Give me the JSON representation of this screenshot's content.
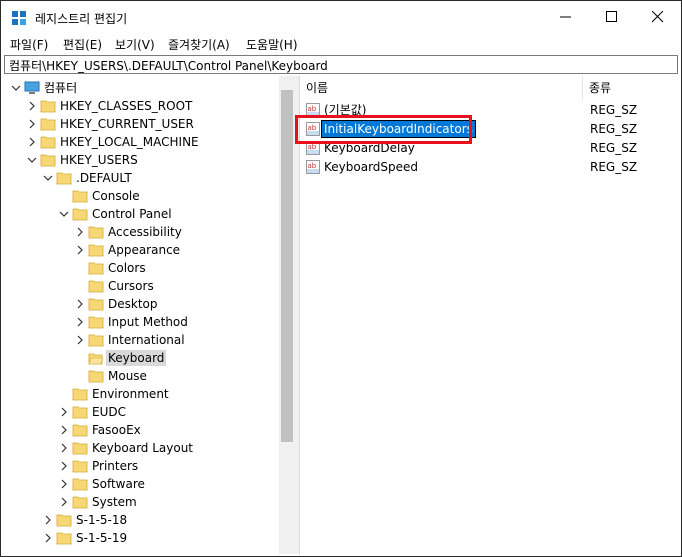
{
  "window": {
    "title": "레지스트리 편집기",
    "app_icon": "registry-editor-icon",
    "controls": {
      "minimize": "minimize-icon",
      "maximize": "maximize-icon",
      "close": "close-icon"
    }
  },
  "menu": [
    "파일(F)",
    "편집(E)",
    "보기(V)",
    "즐겨찾기(A)",
    "도움말(H)"
  ],
  "address": "컴퓨터\\HKEY_USERS\\.DEFAULT\\Control Panel\\Keyboard",
  "tree": [
    {
      "label": "컴퓨터",
      "icon": "computer-icon",
      "depth": 0,
      "expander": "expanded"
    },
    {
      "label": "HKEY_CLASSES_ROOT",
      "icon": "folder-icon",
      "depth": 1,
      "expander": "collapsed"
    },
    {
      "label": "HKEY_CURRENT_USER",
      "icon": "folder-icon",
      "depth": 1,
      "expander": "collapsed"
    },
    {
      "label": "HKEY_LOCAL_MACHINE",
      "icon": "folder-icon",
      "depth": 1,
      "expander": "collapsed"
    },
    {
      "label": "HKEY_USERS",
      "icon": "folder-icon",
      "depth": 1,
      "expander": "expanded"
    },
    {
      "label": ".DEFAULT",
      "icon": "folder-icon",
      "depth": 2,
      "expander": "expanded"
    },
    {
      "label": "Console",
      "icon": "folder-icon",
      "depth": 3,
      "expander": "none"
    },
    {
      "label": "Control Panel",
      "icon": "folder-icon",
      "depth": 3,
      "expander": "expanded"
    },
    {
      "label": "Accessibility",
      "icon": "folder-icon",
      "depth": 4,
      "expander": "collapsed"
    },
    {
      "label": "Appearance",
      "icon": "folder-icon",
      "depth": 4,
      "expander": "collapsed"
    },
    {
      "label": "Colors",
      "icon": "folder-icon",
      "depth": 4,
      "expander": "none"
    },
    {
      "label": "Cursors",
      "icon": "folder-icon",
      "depth": 4,
      "expander": "none"
    },
    {
      "label": "Desktop",
      "icon": "folder-icon",
      "depth": 4,
      "expander": "collapsed"
    },
    {
      "label": "Input Method",
      "icon": "folder-icon",
      "depth": 4,
      "expander": "collapsed"
    },
    {
      "label": "International",
      "icon": "folder-icon",
      "depth": 4,
      "expander": "collapsed"
    },
    {
      "label": "Keyboard",
      "icon": "folder-open-icon",
      "depth": 4,
      "expander": "none",
      "selected": true
    },
    {
      "label": "Mouse",
      "icon": "folder-icon",
      "depth": 4,
      "expander": "none"
    },
    {
      "label": "Environment",
      "icon": "folder-icon",
      "depth": 3,
      "expander": "none"
    },
    {
      "label": "EUDC",
      "icon": "folder-icon",
      "depth": 3,
      "expander": "collapsed"
    },
    {
      "label": "FasooEx",
      "icon": "folder-icon",
      "depth": 3,
      "expander": "collapsed"
    },
    {
      "label": "Keyboard Layout",
      "icon": "folder-icon",
      "depth": 3,
      "expander": "collapsed"
    },
    {
      "label": "Printers",
      "icon": "folder-icon",
      "depth": 3,
      "expander": "collapsed"
    },
    {
      "label": "Software",
      "icon": "folder-icon",
      "depth": 3,
      "expander": "collapsed"
    },
    {
      "label": "System",
      "icon": "folder-icon",
      "depth": 3,
      "expander": "collapsed"
    },
    {
      "label": "S-1-5-18",
      "icon": "folder-icon",
      "depth": 2,
      "expander": "collapsed"
    },
    {
      "label": "S-1-5-19",
      "icon": "folder-icon",
      "depth": 2,
      "expander": "collapsed"
    }
  ],
  "list": {
    "columns": [
      "이름",
      "종류"
    ],
    "rows": [
      {
        "name": "(기본값)",
        "type": "REG_SZ",
        "icon": "string-value-icon"
      },
      {
        "name": "InitialKeyboardIndicators",
        "type": "REG_SZ",
        "icon": "string-value-icon",
        "editing": true
      },
      {
        "name": "KeyboardDelay",
        "type": "REG_SZ",
        "icon": "string-value-icon"
      },
      {
        "name": "KeyboardSpeed",
        "type": "REG_SZ",
        "icon": "string-value-icon"
      }
    ]
  },
  "colors": {
    "highlight_box": "#e8101b",
    "edit_selection": "#0078d7",
    "folder": "#f8d775",
    "tree_selected": "#d9d9d9"
  }
}
